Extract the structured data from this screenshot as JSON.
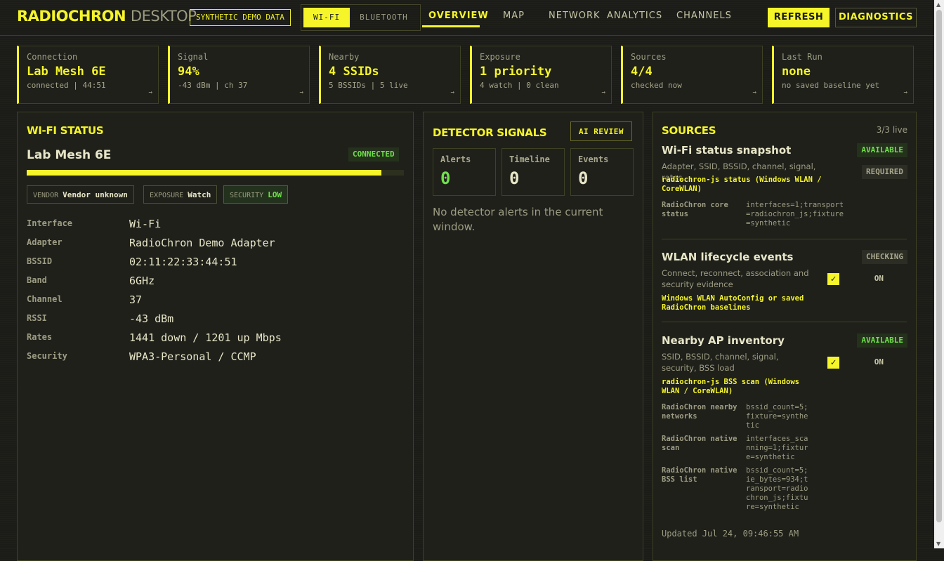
{
  "header": {
    "logo_main": "RADIOCHRON",
    "logo_sub": "DESKTOP",
    "demo_badge": "SYNTHETIC DEMO DATA",
    "mode_tabs": [
      "WI-FI",
      "BLUETOOTH"
    ],
    "nav": [
      "OVERVIEW",
      "MAP",
      "NETWORK",
      "ANALYTICS",
      "CHANNELS"
    ],
    "refresh_label": "REFRESH",
    "diagnostics_label": "DIAGNOSTICS"
  },
  "stats": [
    {
      "label": "Connection",
      "value": "Lab Mesh 6E",
      "sub": "connected | 44:51"
    },
    {
      "label": "Signal",
      "value": "94%",
      "sub": "-43 dBm | ch 37"
    },
    {
      "label": "Nearby",
      "value": "4 SSIDs",
      "sub": "5 BSSIDs | 5 live"
    },
    {
      "label": "Exposure",
      "value": "1 priority",
      "sub": "4 watch | 0 clean"
    },
    {
      "label": "Sources",
      "value": "4/4",
      "sub": "checked now"
    },
    {
      "label": "Last Run",
      "value": "none",
      "sub": "no saved baseline yet"
    }
  ],
  "card_arrow": "→",
  "wifi": {
    "title": "WI-FI STATUS",
    "ssid": "Lab Mesh 6E",
    "status": "CONNECTED",
    "signal_percent": 94,
    "chips": [
      {
        "key": "VENDOR",
        "value": "Vendor unknown"
      },
      {
        "key": "EXPOSURE",
        "value": "Watch"
      },
      {
        "key": "SECURITY",
        "value": "LOW"
      }
    ],
    "details": [
      {
        "key": "Interface",
        "value": "Wi-Fi"
      },
      {
        "key": "Adapter",
        "value": "RadioChron Demo Adapter"
      },
      {
        "key": "BSSID",
        "value": "02:11:22:33:44:51"
      },
      {
        "key": "Band",
        "value": "6GHz"
      },
      {
        "key": "Channel",
        "value": "37"
      },
      {
        "key": "RSSI",
        "value": "-43 dBm"
      },
      {
        "key": "Rates",
        "value": "1441 down / 1201 up Mbps"
      },
      {
        "key": "Security",
        "value": "WPA3-Personal / CCMP"
      }
    ]
  },
  "detector": {
    "title": "DETECTOR SIGNALS",
    "ai_review": "AI REVIEW",
    "metrics": [
      {
        "label": "Alerts",
        "value": "0",
        "color": "#6fe04a"
      },
      {
        "label": "Timeline",
        "value": "0",
        "color": "#e8e6c8"
      },
      {
        "label": "Events",
        "value": "0",
        "color": "#e8e6c8"
      }
    ],
    "empty": "No detector alerts in the current window."
  },
  "sources": {
    "title": "SOURCES",
    "live": "3/3 live",
    "s1": {
      "title": "Wi-Fi status snapshot",
      "badge": "AVAILABLE",
      "badge2": "REQUIRED",
      "desc": "Adapter, SSID, BSSID, channel, signal, rates",
      "link": "radiochron-js status (Windows WLAN / CoreWLAN)",
      "evidence": [
        {
          "key": "RadioChron core status",
          "value": "interfaces=1;transport=radiochron_js;fixture=synthetic"
        }
      ]
    },
    "s2": {
      "title": "WLAN lifecycle events",
      "badge": "CHECKING",
      "toggle": "ON",
      "check": "✓",
      "desc": "Connect, reconnect, association and security evidence",
      "link": "Windows WLAN AutoConfig or saved RadioChron baselines"
    },
    "s3": {
      "title": "Nearby AP inventory",
      "badge": "AVAILABLE",
      "toggle": "ON",
      "check": "✓",
      "desc": "SSID, BSSID, channel, signal, security, BSS load",
      "link": "radiochron-js BSS scan (Windows WLAN / CoreWLAN)",
      "evidence": [
        {
          "key": "RadioChron nearby networks",
          "value": "bssid_count=5;fixture=synthetic"
        },
        {
          "key": "RadioChron native scan",
          "value": "interfaces_scanning=1;fixture=synthetic"
        },
        {
          "key": "RadioChron native BSS list",
          "value": "bssid_count=5;ie_bytes=934;transport=radiochron_js;fixture=synthetic"
        }
      ]
    },
    "updated": "Updated Jul 24, 09:46:55 AM"
  },
  "colors": {
    "accent": "#f5f52a",
    "ok": "#6fe04a",
    "bg": "#1b1c17"
  },
  "icons": {
    "card_arrow": "arrow-right-icon",
    "check": "checkbox-icon"
  }
}
